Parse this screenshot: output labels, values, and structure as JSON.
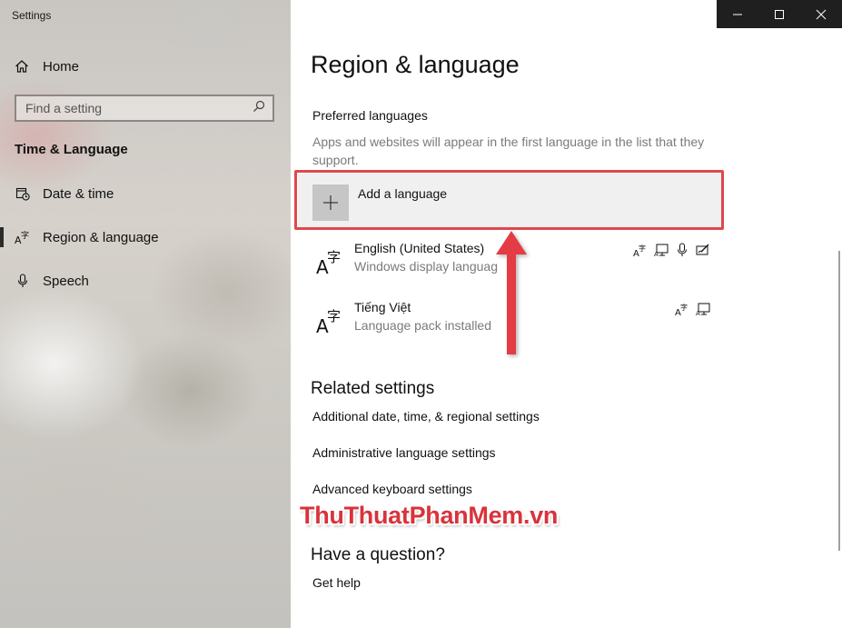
{
  "window": {
    "title": "Settings"
  },
  "sidebar": {
    "home_label": "Home",
    "search_placeholder": "Find a setting",
    "section_title": "Time & Language",
    "items": [
      {
        "label": "Date & time",
        "icon": "date-time-icon",
        "active": false
      },
      {
        "label": "Region & language",
        "icon": "region-language-icon",
        "active": true
      },
      {
        "label": "Speech",
        "icon": "microphone-icon",
        "active": false
      }
    ]
  },
  "main": {
    "title": "Region & language",
    "preferred_languages": {
      "heading": "Preferred languages",
      "description": "Apps and websites will appear in the first language in the list that they support.",
      "add_label": "Add a language",
      "languages": [
        {
          "name": "English (United States)",
          "status": "Windows display languag",
          "features": [
            "language-pack-icon",
            "display-icon",
            "speech-icon",
            "handwriting-icon"
          ]
        },
        {
          "name": "Tiếng Việt",
          "status": "Language pack installed",
          "features": [
            "language-pack-icon",
            "display-icon"
          ]
        }
      ]
    },
    "related": {
      "heading": "Related settings",
      "links": [
        "Additional date, time, & regional settings",
        "Administrative language settings",
        "Advanced keyboard settings"
      ]
    },
    "question": {
      "heading": "Have a question?",
      "link": "Get help"
    }
  },
  "watermark": "ThuThuatPhanMem.vn",
  "colors": {
    "accent_highlight": "#e0474c",
    "titlebar": "#1f1f1f"
  }
}
